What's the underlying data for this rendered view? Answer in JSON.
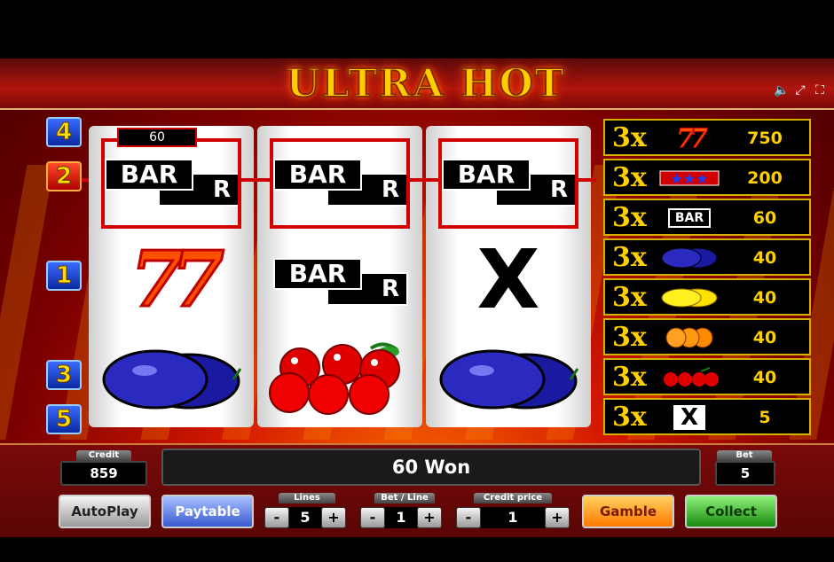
{
  "header": {
    "logo": "ULTRA HOT",
    "icons": [
      "speaker-icon",
      "expand-icon",
      "fullscreen-icon"
    ]
  },
  "lines": [
    {
      "label": "4",
      "color": "blue"
    },
    {
      "label": "2",
      "color": "red"
    },
    {
      "label": "1",
      "color": "blue"
    },
    {
      "label": "3",
      "color": "blue"
    },
    {
      "label": "5",
      "color": "blue"
    }
  ],
  "reels": [
    [
      "BAR",
      "77",
      "plum"
    ],
    [
      "BAR",
      "BAR",
      "cherries"
    ],
    [
      "BAR",
      "X",
      "plum"
    ]
  ],
  "symbol_text": {
    "bar": "BAR",
    "bar_back": "R",
    "seven": "77",
    "x": "X"
  },
  "win_tag": "60",
  "paytable": [
    {
      "prefix": "3x",
      "symbol": "seven",
      "payout": "750"
    },
    {
      "prefix": "3x",
      "symbol": "stars",
      "payout": "200"
    },
    {
      "prefix": "3x",
      "symbol": "bar",
      "payout": "60"
    },
    {
      "prefix": "3x",
      "symbol": "plum",
      "payout": "40"
    },
    {
      "prefix": "3x",
      "symbol": "lemon",
      "payout": "40"
    },
    {
      "prefix": "3x",
      "symbol": "orange",
      "payout": "40"
    },
    {
      "prefix": "3x",
      "symbol": "cherries",
      "payout": "40"
    },
    {
      "prefix": "3x",
      "symbol": "x",
      "payout": "5"
    }
  ],
  "panel": {
    "credit_label": "Credit",
    "credit_value": "859",
    "message": "60 Won",
    "bet_label": "Bet",
    "bet_value": "5",
    "autoplay": "AutoPlay",
    "paytable": "Paytable",
    "lines_label": "Lines",
    "lines_value": "5",
    "betline_label": "Bet / Line",
    "betline_value": "1",
    "creditprice_label": "Credit price",
    "creditprice_value": "1",
    "minus": "-",
    "plus": "+",
    "gamble": "Gamble",
    "collect": "Collect"
  }
}
